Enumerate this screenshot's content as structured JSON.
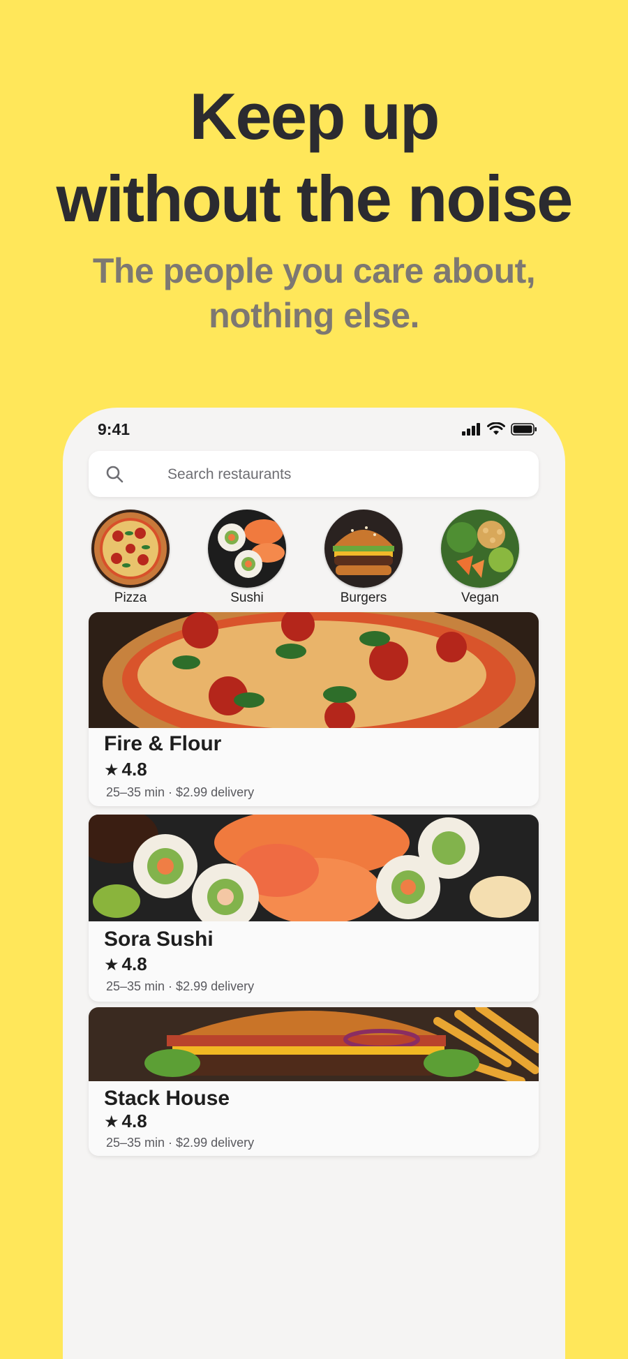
{
  "hero": {
    "title_line1": "Keep up",
    "title_line2": "without the noise",
    "subtitle_line1": "The people you care about,",
    "subtitle_line2": "nothing else."
  },
  "status_bar": {
    "time": "9:41"
  },
  "search": {
    "placeholder": "Search restaurants"
  },
  "categories": [
    {
      "label": "Pizza",
      "icon": "pizza-image"
    },
    {
      "label": "Sushi",
      "icon": "sushi-image"
    },
    {
      "label": "Burgers",
      "icon": "burger-image"
    },
    {
      "label": "Vegan",
      "icon": "vegan-bowl-image"
    }
  ],
  "restaurants": [
    {
      "name": "Fire & Flour",
      "rating": "4.8",
      "meta": "25–35 min · $2.99 delivery"
    },
    {
      "name": "Sora Sushi",
      "rating": "4.8",
      "meta": "25–35 min · $2.99 delivery"
    },
    {
      "name": "Stack House",
      "rating": "4.8",
      "meta": "25–35 min · $2.99 delivery"
    }
  ],
  "colors": {
    "background": "#FFE75A",
    "phone": "#F5F4F3",
    "title": "#2B2B30",
    "subtitle": "#7D7872"
  }
}
